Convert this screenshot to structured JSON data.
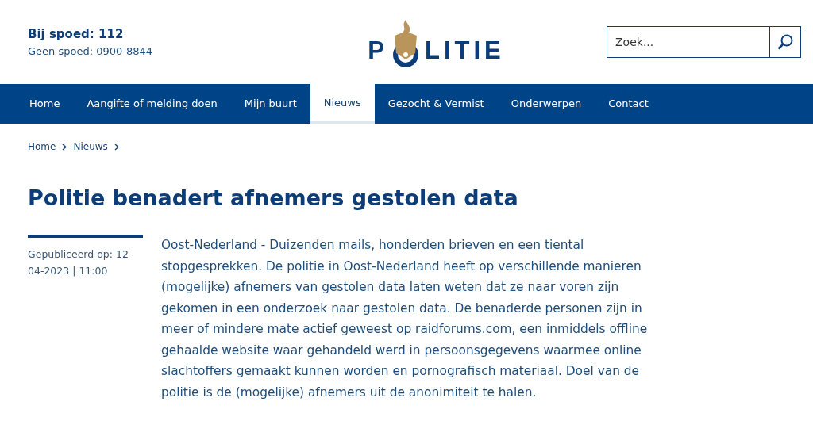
{
  "header": {
    "emergency": "Bij spoed: 112",
    "non_emergency": "Geen spoed: 0900-8844",
    "logo": {
      "before": "P",
      "after": "LITIE"
    },
    "search": {
      "placeholder": "Zoek..."
    }
  },
  "nav": [
    {
      "label": "Home",
      "selected": false
    },
    {
      "label": "Aangifte of melding doen",
      "selected": false
    },
    {
      "label": "Mijn buurt",
      "selected": false
    },
    {
      "label": "Nieuws",
      "selected": true
    },
    {
      "label": "Gezocht & Vermist",
      "selected": false
    },
    {
      "label": "Onderwerpen",
      "selected": false
    },
    {
      "label": "Contact",
      "selected": false
    }
  ],
  "breadcrumb": [
    "Home",
    "Nieuws"
  ],
  "article": {
    "title": "Politie benadert afnemers gestolen data",
    "published": "Gepubliceerd op: 12-04-2023 | 11:00",
    "body": "Oost-Nederland - Duizenden mails, honderden brieven en een tiental stopgesprekken. De politie in Oost-Nederland heeft op verschillende manieren (mogelijke) afnemers van gestolen data laten weten dat ze naar voren zijn gekomen in een onderzoek naar gestolen data. De benaderde personen zijn in meer of mindere mate actief geweest op raidforums.com, een inmiddels offline gehaalde website waar gehandeld werd in persoonsgegevens waarmee online slachtoffers gemaakt kunnen worden en pornografisch materiaal. Doel van de politie is de (mogelijke) afnemers uit de anonimiteit te halen."
  }
}
